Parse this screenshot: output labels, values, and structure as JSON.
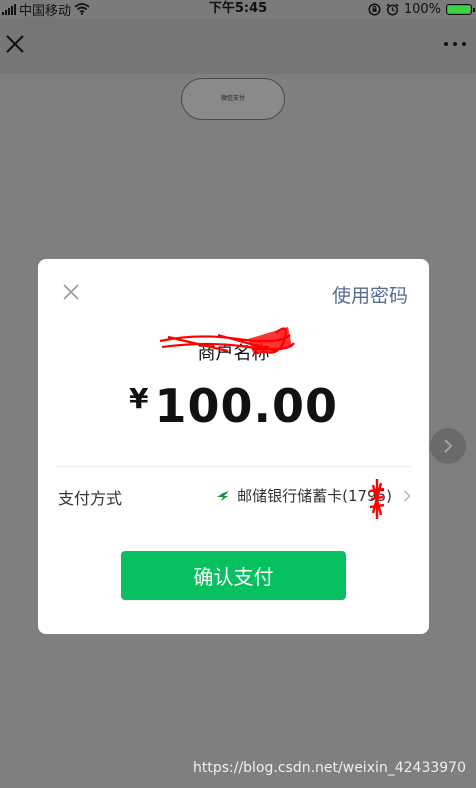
{
  "status_bar": {
    "carrier": "中国移动",
    "time": "下午5:45",
    "battery_percent": "100%",
    "battery_level": 1.0,
    "icons": [
      "signal-icon",
      "wifi-icon",
      "rotation-lock-icon",
      "alarm-icon",
      "battery-icon"
    ]
  },
  "nav": {
    "icons": [
      "close-icon",
      "more-icon"
    ]
  },
  "background": {
    "pill_button_label": "微信支付"
  },
  "dialog": {
    "use_password": "使用密码",
    "merchant_name": "商户名称",
    "currency_symbol": "¥",
    "amount": "100.00",
    "payment_method_label": "支付方式",
    "payment_method_value": "邮储银行储蓄卡(1795)",
    "confirm_button": "确认支付"
  },
  "colors": {
    "accent_green": "#07c160",
    "link_blue": "#576b95",
    "overlay": "#7f7f7f"
  },
  "watermark": "https://blog.csdn.net/weixin_42433970"
}
